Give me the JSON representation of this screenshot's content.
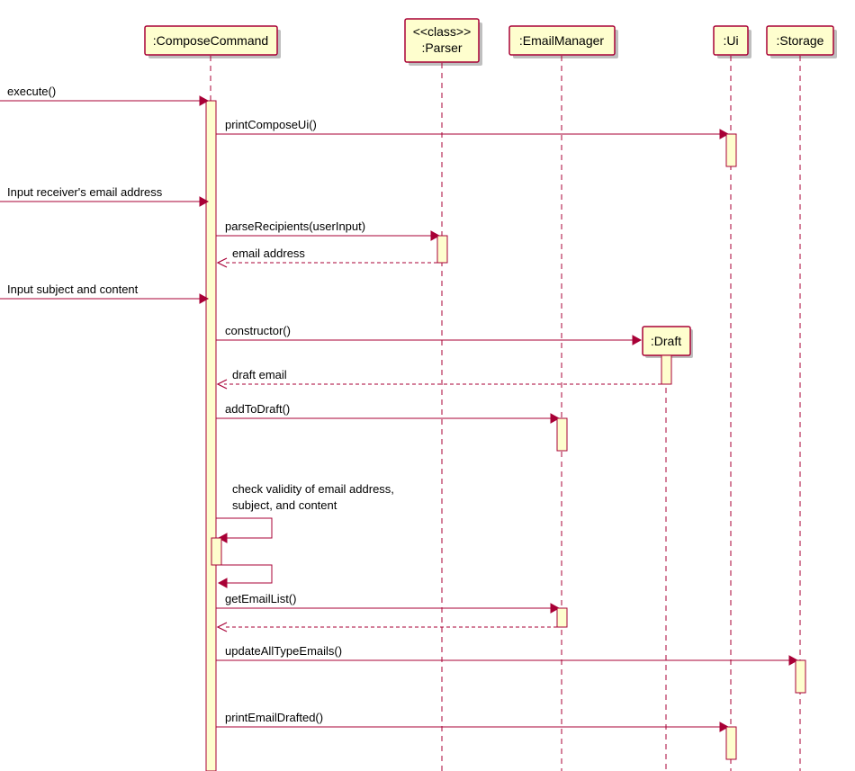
{
  "participants": {
    "composeCommand": ":ComposeCommand",
    "parser": "<<class>>\n:Parser",
    "parserStereo": "<<class>>",
    "parserName": ":Parser",
    "emailManager": ":EmailManager",
    "ui": ":Ui",
    "storage": ":Storage",
    "draft": ":Draft"
  },
  "messages": {
    "execute": "execute()",
    "printComposeUi": "printComposeUi()",
    "inputReceiver": "Input receiver's email address",
    "parseRecipients": "parseRecipients(userInput)",
    "emailAddressReturn": "email address",
    "inputSubject": "Input subject and content",
    "constructor": "constructor()",
    "draftEmailReturn": "draft email",
    "addToDraft": "addToDraft()",
    "checkValidity": "check validity of email address,\nsubject, and content",
    "checkValidityLine1": "check validity of email address,",
    "checkValidityLine2": "subject, and content",
    "getEmailList": "getEmailList()",
    "updateAllTypeEmails": "updateAllTypeEmails()",
    "printEmailDrafted": "printEmailDrafted()"
  }
}
